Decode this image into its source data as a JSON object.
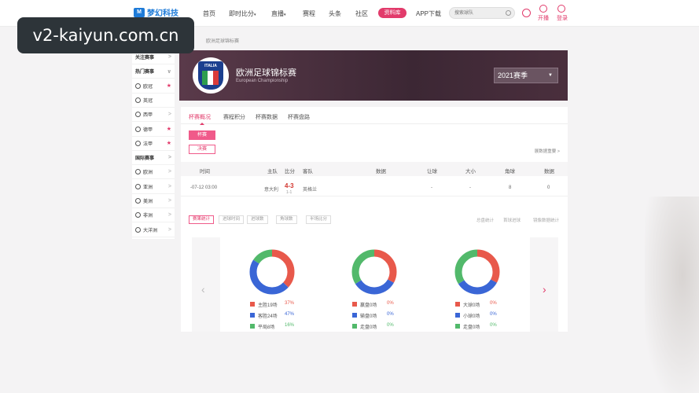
{
  "watermark": "v2-kaiyun.com.cn",
  "logo": {
    "mark": "M",
    "text": "梦幻科技"
  },
  "nav": {
    "items": [
      "首页",
      "即时比分",
      "直播",
      "赛程",
      "头条",
      "社区"
    ],
    "dropdown_marks": [
      "▾",
      "▾"
    ],
    "highlight": "资料库",
    "app": "APP下载",
    "search_placeholder": "搜索球队",
    "kaibo": "开播",
    "login": "登录"
  },
  "breadcrumb": "欧洲足球锦标赛",
  "sidebar": {
    "items": [
      {
        "label": "关注赛事",
        "type": "header",
        "mark": ">"
      },
      {
        "label": "热门赛事",
        "type": "header",
        "mark": "∨"
      },
      {
        "label": "欧冠",
        "type": "item",
        "mark": "★"
      },
      {
        "label": "英冠",
        "type": "item",
        "mark": ""
      },
      {
        "label": "西甲",
        "type": "item",
        "mark": ">"
      },
      {
        "label": "德甲",
        "type": "item",
        "mark": "★"
      },
      {
        "label": "法甲",
        "type": "item",
        "mark": "★"
      },
      {
        "label": "国际赛事",
        "type": "header",
        "mark": ">"
      },
      {
        "label": "欧洲",
        "type": "item",
        "mark": ">"
      },
      {
        "label": "亚洲",
        "type": "item",
        "mark": ">"
      },
      {
        "label": "美洲",
        "type": "item",
        "mark": ">"
      },
      {
        "label": "非洲",
        "type": "item",
        "mark": ">"
      },
      {
        "label": "大洋洲",
        "type": "item",
        "mark": ">"
      }
    ]
  },
  "banner": {
    "badge_text": "ITALIA",
    "title": "欧洲足球锦标赛",
    "subtitle": "European Championship",
    "season": "2021赛季",
    "season_arrow": "▼"
  },
  "tabs": [
    "杯赛概况",
    "赛程积分",
    "杯赛数据",
    "杯赛盘路"
  ],
  "buttons": {
    "cup": "杯赛",
    "final": "决赛"
  },
  "right_link": "展数据重要 >",
  "table": {
    "headers": [
      "时间",
      "主队",
      "比分",
      "客队",
      "数据",
      "让球",
      "大小",
      "角球",
      "数据"
    ],
    "row": {
      "time": "-07-12 03:00",
      "home": "意大利",
      "score": "4-3",
      "half": "1-1",
      "away": "英格兰",
      "handicap": "-",
      "overunder": "-",
      "corner": "8",
      "data": "0"
    }
  },
  "stat_tabs": [
    "赛果统计",
    "进球时间",
    "进球数",
    "角球数",
    "半场比分"
  ],
  "stat_links": [
    "总盘统计",
    "首球进球",
    "镜像数据统计"
  ],
  "carousel": {
    "prev": "‹",
    "next": "›",
    "charts": [
      {
        "legend": [
          {
            "label": "主胜19场",
            "pct": "37%",
            "color": "#e8594b"
          },
          {
            "label": "客胜24场",
            "pct": "47%",
            "color": "#3a66d6"
          },
          {
            "label": "平局8场",
            "pct": "16%",
            "color": "#52b96b"
          }
        ],
        "values": [
          37,
          47,
          16
        ]
      },
      {
        "legend": [
          {
            "label": "赢盘0场",
            "pct": "0%",
            "color": "#e8594b"
          },
          {
            "label": "输盘0场",
            "pct": "0%",
            "color": "#3a66d6"
          },
          {
            "label": "走盘0场",
            "pct": "0%",
            "color": "#52b96b"
          }
        ],
        "values": [
          33,
          33,
          34
        ]
      },
      {
        "legend": [
          {
            "label": "大球0场",
            "pct": "0%",
            "color": "#e8594b"
          },
          {
            "label": "小球0场",
            "pct": "0%",
            "color": "#3a66d6"
          },
          {
            "label": "走盘0场",
            "pct": "0%",
            "color": "#52b96b"
          }
        ],
        "values": [
          33,
          33,
          34
        ]
      }
    ]
  }
}
